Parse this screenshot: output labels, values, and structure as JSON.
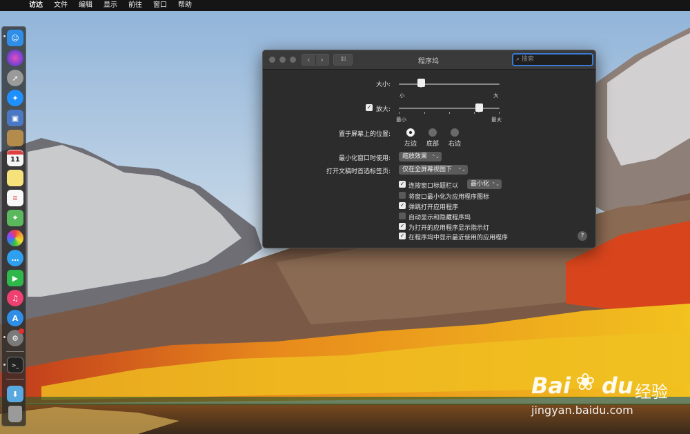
{
  "menubar": {
    "apple_glyph": "",
    "items": [
      "访达",
      "文件",
      "编辑",
      "显示",
      "前往",
      "窗口",
      "帮助"
    ]
  },
  "window": {
    "title": "程序坞",
    "search_placeholder": "搜索",
    "nav_back": "‹",
    "nav_forward": "›",
    "grid_glyph": "⁞⁞⁞⁞"
  },
  "size": {
    "label": "大小:",
    "min_label": "小",
    "max_label": "大",
    "value": 0.22
  },
  "magnification": {
    "label": "放大:",
    "checked": true,
    "min_label": "最小",
    "max_label": "最大",
    "value": 0.8
  },
  "position": {
    "label": "置于屏幕上的位置:",
    "options": [
      "左边",
      "底部",
      "右边"
    ],
    "selected": "左边"
  },
  "minimize_using": {
    "label": "最小化窗口时使用:",
    "value": "缩放效果"
  },
  "prefer_tabs": {
    "label": "打开文稿时首选标签页:",
    "value": "仅在全屏幕视图下"
  },
  "checkboxes": [
    {
      "label": "连按窗口标题栏以",
      "checked": true,
      "popup": "最小化"
    },
    {
      "label": "将窗口最小化为应用程序图标",
      "checked": false
    },
    {
      "label": "弹跳打开应用程序",
      "checked": true
    },
    {
      "label": "自动显示和隐藏程序坞",
      "checked": false
    },
    {
      "label": "为打开的应用程序显示指示灯",
      "checked": true
    },
    {
      "label": "在程序坞中显示最近使用的应用程序",
      "checked": true
    }
  ],
  "help_glyph": "?",
  "dock": {
    "calendar_day": "11",
    "items": [
      {
        "name": "finder-icon",
        "color": "#2f8fe8"
      },
      {
        "name": "siri-icon",
        "color": "#7a3ad8"
      },
      {
        "name": "launchpad-icon",
        "color": "#8c8c8c"
      },
      {
        "name": "safari-icon",
        "color": "#1e90ff"
      },
      {
        "name": "photo-viewer-icon",
        "color": "#4a78c4"
      },
      {
        "name": "contacts-icon",
        "color": "#b38b4a"
      },
      {
        "name": "calendar-icon",
        "color": "#f4f4f4"
      },
      {
        "name": "notes-icon",
        "color": "#f6e27a"
      },
      {
        "name": "reminders-icon",
        "color": "#f8f8f8"
      },
      {
        "name": "maps-icon",
        "color": "#5cb85c"
      },
      {
        "name": "photos-icon",
        "color": "#f0a030"
      },
      {
        "name": "messages-icon",
        "color": "#2fa0f0"
      },
      {
        "name": "facetime-icon",
        "color": "#2fb84a"
      },
      {
        "name": "music-icon",
        "color": "#f04070"
      },
      {
        "name": "app-store-icon",
        "color": "#2f8fe8"
      },
      {
        "name": "system-preferences-icon",
        "color": "#7a7a7a"
      },
      {
        "name": "terminal-icon",
        "color": "#222222"
      },
      {
        "name": "downloads-folder-icon",
        "color": "#5aa8e0"
      },
      {
        "name": "trash-icon",
        "color": "#9a9a9a"
      }
    ]
  },
  "watermark": {
    "brand": "Bai",
    "brand2": "du",
    "suffix": "经验",
    "url": "jingyan.baidu.com"
  }
}
